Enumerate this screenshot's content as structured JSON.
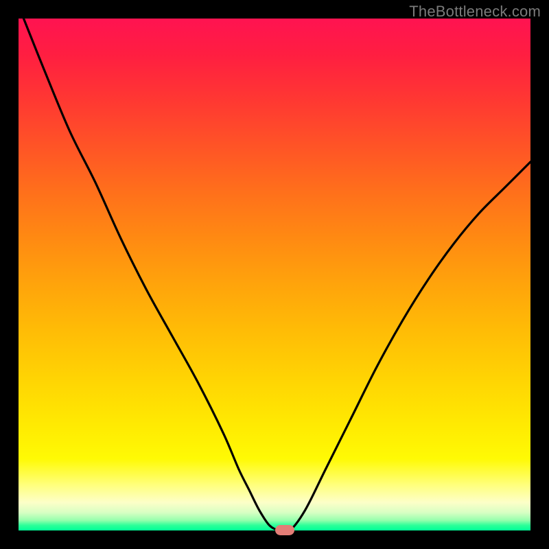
{
  "watermark": "TheBottleneck.com",
  "colors": {
    "background": "#000000",
    "curve": "#000000",
    "marker": "#e47e77"
  },
  "chart_data": {
    "type": "line",
    "title": "",
    "xlabel": "",
    "ylabel": "",
    "xlim": [
      0,
      100
    ],
    "ylim": [
      0,
      100
    ],
    "series": [
      {
        "name": "bottleneck-curve",
        "x": [
          1,
          5,
          10,
          15,
          20,
          25,
          30,
          35,
          40,
          43,
          45,
          47,
          49,
          51,
          53,
          56,
          60,
          65,
          70,
          75,
          80,
          85,
          90,
          95,
          100
        ],
        "y": [
          100,
          90,
          78,
          68,
          57,
          47,
          38,
          29,
          19,
          12,
          8,
          4,
          1,
          0,
          0,
          4,
          12,
          22,
          32,
          41,
          49,
          56,
          62,
          67,
          72
        ]
      }
    ],
    "annotations": [
      {
        "name": "optimal-marker",
        "x": 52,
        "y": 0
      }
    ],
    "grid": false,
    "legend": false
  }
}
